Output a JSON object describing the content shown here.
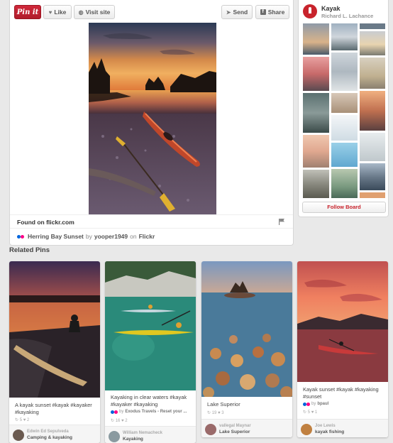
{
  "toolbar": {
    "pin_label": "Pin it",
    "like_label": "Like",
    "visit_label": "Visit site",
    "send_label": "Send",
    "share_label": "Share"
  },
  "pin": {
    "found_text": "Found on flickr.com",
    "title": "Herring Bay Sunset",
    "by_word": "by",
    "author": "yooper1949",
    "on_word": "on",
    "source": "Flickr"
  },
  "board": {
    "title": "Kayak",
    "owner": "Richard L. Lachance",
    "follow_label": "Follow Board"
  },
  "related": {
    "heading": "Related Pins",
    "pins": [
      {
        "description": "A kayak sunset #kayak #kayaker #kayaking",
        "via": "",
        "stats": "↻ 5  ♥ 2",
        "user": "Edwin Ed Sepulveda",
        "board": "Camping & kayaking"
      },
      {
        "description": "Kayaking in clear waters #kayak #kayaker #kayaking",
        "via": "Exodus Travels - Reset your ...",
        "stats": "↻ 16  ♥ 2",
        "user": "William Nemacheck",
        "board": "Kayaking"
      },
      {
        "description": "Lake Superior",
        "via": "",
        "stats": "↻ 19  ♥ 3",
        "user": "vallegal Maynar",
        "board": "Lake Superior"
      },
      {
        "description": "Kayak sunset #kayak #kayaking #sunset",
        "via": "bpaul",
        "stats": "↻ 5  ♥ 1",
        "user": "Joe Lewis",
        "board": "kayak fishing"
      }
    ]
  },
  "colors": {
    "pinterest_red": "#c8232c",
    "background": "#e9e9e9"
  }
}
